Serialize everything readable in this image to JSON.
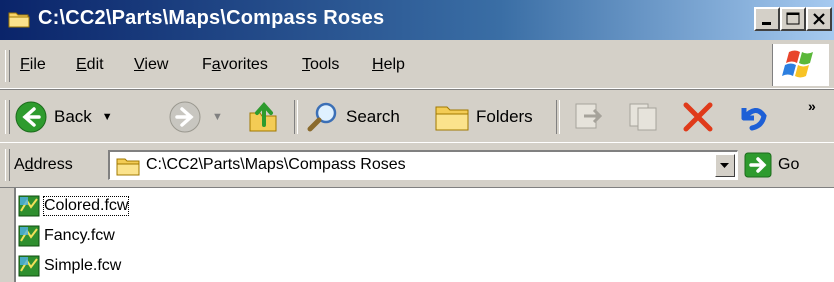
{
  "window": {
    "title": "C:\\CC2\\Parts\\Maps\\Compass Roses"
  },
  "menu": [
    {
      "label_pre": "",
      "accel": "F",
      "label_post": "ile"
    },
    {
      "label_pre": "",
      "accel": "E",
      "label_post": "dit"
    },
    {
      "label_pre": "",
      "accel": "V",
      "label_post": "iew"
    },
    {
      "label_pre": "F",
      "accel": "a",
      "label_post": "vorites"
    },
    {
      "label_pre": "",
      "accel": "T",
      "label_post": "ools"
    },
    {
      "label_pre": "",
      "accel": "H",
      "label_post": "elp"
    }
  ],
  "toolbar": {
    "back_label": "Back",
    "search_label": "Search",
    "folders_label": "Folders"
  },
  "address": {
    "label_pre": "A",
    "label_accel": "d",
    "label_post": "dress",
    "value": "C:\\CC2\\Parts\\Maps\\Compass Roses",
    "go_label": "Go"
  },
  "files": [
    {
      "name": "Colored.fcw"
    },
    {
      "name": "Fancy.fcw"
    },
    {
      "name": "Simple.fcw"
    }
  ],
  "colors": {
    "titlebar_start": "#0a246a",
    "titlebar_end": "#a6caf0",
    "chrome": "#d4d0c8"
  }
}
